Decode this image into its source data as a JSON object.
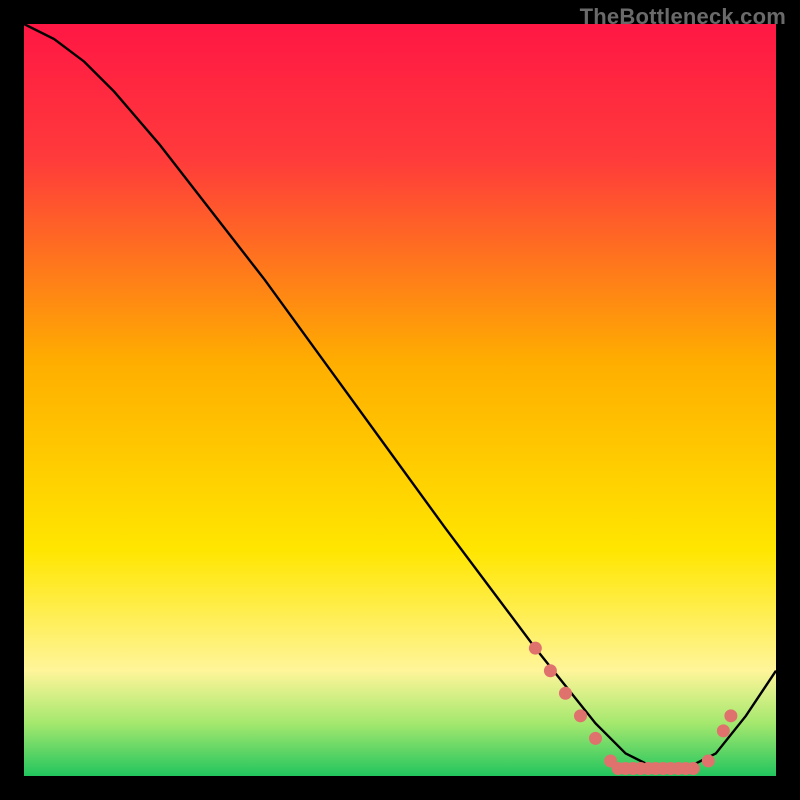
{
  "watermark": "TheBottleneck.com",
  "colors": {
    "gradient_top": "#ff1744",
    "gradient_upper": "#ff3b3b",
    "gradient_mid": "#ffae00",
    "gradient_yellow": "#ffe600",
    "gradient_pale": "#fff59a",
    "gradient_green_light": "#a4e86e",
    "gradient_green": "#22c55e",
    "curve": "#000000",
    "marker": "#e0726e"
  },
  "chart_data": {
    "type": "line",
    "title": "",
    "xlabel": "",
    "ylabel": "",
    "xlim": [
      0,
      100
    ],
    "ylim": [
      0,
      100
    ],
    "series": [
      {
        "name": "curve",
        "x": [
          0,
          4,
          8,
          12,
          18,
          25,
          32,
          40,
          48,
          56,
          62,
          68,
          72,
          76,
          80,
          84,
          88,
          92,
          96,
          100
        ],
        "y": [
          100,
          98,
          95,
          91,
          84,
          75,
          66,
          55,
          44,
          33,
          25,
          17,
          12,
          7,
          3,
          1,
          1,
          3,
          8,
          14
        ]
      }
    ],
    "markers": [
      {
        "x": 68,
        "y": 17
      },
      {
        "x": 70,
        "y": 14
      },
      {
        "x": 72,
        "y": 11
      },
      {
        "x": 74,
        "y": 8
      },
      {
        "x": 76,
        "y": 5
      },
      {
        "x": 78,
        "y": 2
      },
      {
        "x": 79,
        "y": 1
      },
      {
        "x": 80,
        "y": 1
      },
      {
        "x": 81,
        "y": 1
      },
      {
        "x": 82,
        "y": 1
      },
      {
        "x": 83,
        "y": 1
      },
      {
        "x": 84,
        "y": 1
      },
      {
        "x": 85,
        "y": 1
      },
      {
        "x": 86,
        "y": 1
      },
      {
        "x": 87,
        "y": 1
      },
      {
        "x": 88,
        "y": 1
      },
      {
        "x": 89,
        "y": 1
      },
      {
        "x": 91,
        "y": 2
      },
      {
        "x": 93,
        "y": 6
      },
      {
        "x": 94,
        "y": 8
      }
    ]
  }
}
